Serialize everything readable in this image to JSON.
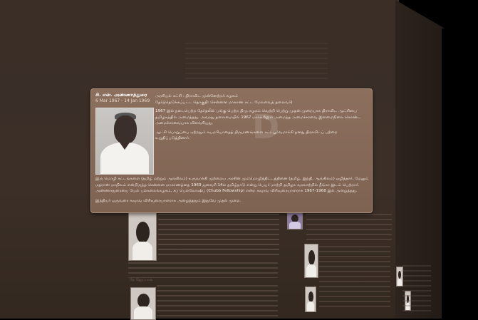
{
  "card": {
    "title": "சி. என். அண்ணாத்துரை",
    "dates": "6 Mar 1967 - 14 Jan 1969",
    "meta_lines": [
      "அரசியல் கட்சி : திராவிட முன்னேற்றக் கழகம்",
      "தேர்ந்தெடுக்கப்பட்ட தொகுதி: சென்னை மாகாண சட்ட மேலவைத் தலைவர்)"
    ],
    "meta_paragraph_1": "1967 இல் நடைபெற்ற தேர்தலில் பங்கு பெற்ற திமு கழகம் வெற்றி பெற்று முதன் முறையாக திராவிட ஆட்சியை தமிழகத்தில் அமைத்தது. அவரது தலைமையில் 1967 மார்ச் 6இல் அமைந்த அமைச்சரவை இளமைநிலை கொண்ட அமைச்சரவையாக விளங்கியது.",
    "meta_paragraph_2": "ஆட்சி பொறுப்பை ஏற்றதும் சுயமரியாதைத் திருமணங்களை சட்டபூர்வமாக்கி தனது திராவிடப் பற்றை உறுதிப்படுத்தினார்.",
    "body_paragraph_1": "இரு மொழி சட்டங்களை (தமிழ் மற்றும் ஆங்கிலம்) உருவாக்கி முற்றைய அரசின் மும்மொழித்திட்டத்தினை (தமிழ், இந்தி, ஆங்கிலம்) ஒழித்தார், மேலும் மதராஸ் மாநிலம் என்றிருந்த சென்னை மாகாணத்தை 1969 ஜனவரி 14ல் தமிழ்நாடு என்று பெயர் மாற்றி தமிழக வரலாற்றில் நீங்கா இடம் பெற்றார். அண்ணாதுரையை யேல் பல்கலைக்கழகம், சப் பெல்லோஷிப் (Chubb Fellowship) என்ற கவுரவ விரிவுரையாளராக 1967-1968 இல் அழைத்தது.",
    "body_paragraph_2": "இந்தியர் ஒருவரை கவுரவ விரிவுரையாளராக அழைத்ததும் இதுவே முதல் முறை.",
    "watermark": "D"
  },
  "background": {
    "faint_heading_1": "தே ஜெய்பால்",
    "faint_heading_2": "தே அரங்கநாதன்"
  }
}
